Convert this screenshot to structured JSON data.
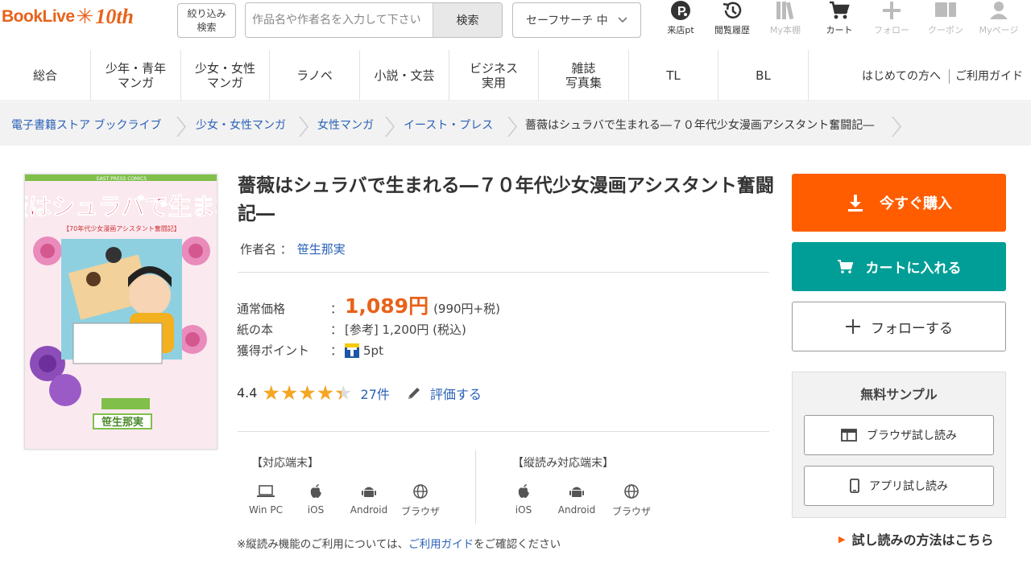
{
  "header": {
    "logo_text": "BookLive",
    "logo_anniv": "10th",
    "filter_line1": "絞り込み",
    "filter_line2": "検索",
    "search_placeholder": "作品名や作者名を入力して下さい",
    "search_button": "検索",
    "safe_search": "セーフサーチ 中",
    "icons": {
      "points": "来店pt",
      "history": "閲覧履歴",
      "shelf": "My本棚",
      "cart": "カート",
      "follow": "フォロー",
      "coupon": "クーポン",
      "mypage": "Myページ"
    }
  },
  "categories": [
    {
      "label": "総合"
    },
    {
      "label": "少年・青年\nマンガ"
    },
    {
      "label": "少女・女性\nマンガ"
    },
    {
      "label": "ラノベ"
    },
    {
      "label": "小説・文芸"
    },
    {
      "label": "ビジネス\n実用"
    },
    {
      "label": "雑誌\n写真集"
    },
    {
      "label": "TL"
    },
    {
      "label": "BL"
    }
  ],
  "help_links": {
    "beginners": "はじめての方へ",
    "guide": "ご利用ガイド"
  },
  "breadcrumb": {
    "home": "電子書籍ストア ブックライブ",
    "cat1": "少女・女性マンガ",
    "cat2": "女性マンガ",
    "publisher": "イースト・プレス",
    "current": "薔薇はシュラバで生まれる―７０年代少女漫画アシスタント奮闘記―"
  },
  "book": {
    "cover_label": "EAST PRESS COMICS",
    "cover_title": "薔薇はシュラバで生まれる",
    "cover_subtitle": "【70年代少女漫画アシスタント奮闘記】",
    "cover_author": "笹生那実",
    "title": "薔薇はシュラバで生まれる―７０年代少女漫画アシスタント奮闘記―",
    "author_label": "作者名 ：",
    "author": "笹生那実",
    "price_label": "通常価格",
    "price": "1,089円",
    "price_tax": "(990円+税)",
    "paper_label": "紙の本",
    "paper_price": "[参考] 1,200円 (税込)",
    "points_label": "獲得ポイント",
    "points": "5pt",
    "colon": "：",
    "rating": "4.4",
    "rating_value": 4.4,
    "stars": "★★★★★",
    "review_count": "27件",
    "review_link": "評価する"
  },
  "devices": {
    "title": "【対応端末】",
    "items": [
      {
        "label": "Win PC"
      },
      {
        "label": "iOS"
      },
      {
        "label": "Android"
      },
      {
        "label": "ブラウザ"
      }
    ],
    "vertical_title": "【縦読み対応端末】",
    "vertical_items": [
      {
        "label": "iOS"
      },
      {
        "label": "Android"
      },
      {
        "label": "ブラウザ"
      }
    ],
    "note_prefix": "※縦読み機能のご利用については、",
    "note_link": "ご利用ガイド",
    "note_suffix": "をご確認ください"
  },
  "actions": {
    "buy": "今すぐ購入",
    "cart": "カートに入れる",
    "follow": "フォローする",
    "sample_title": "無料サンプル",
    "browser_read": "ブラウザ試し読み",
    "app_read": "アプリ試し読み",
    "howto": "試し読みの方法はこちら"
  },
  "colors": {
    "brand_orange": "#e8621a",
    "buy": "#ff5d00",
    "cart": "#009e96",
    "link": "#2b62b7",
    "star": "#f5a623"
  }
}
